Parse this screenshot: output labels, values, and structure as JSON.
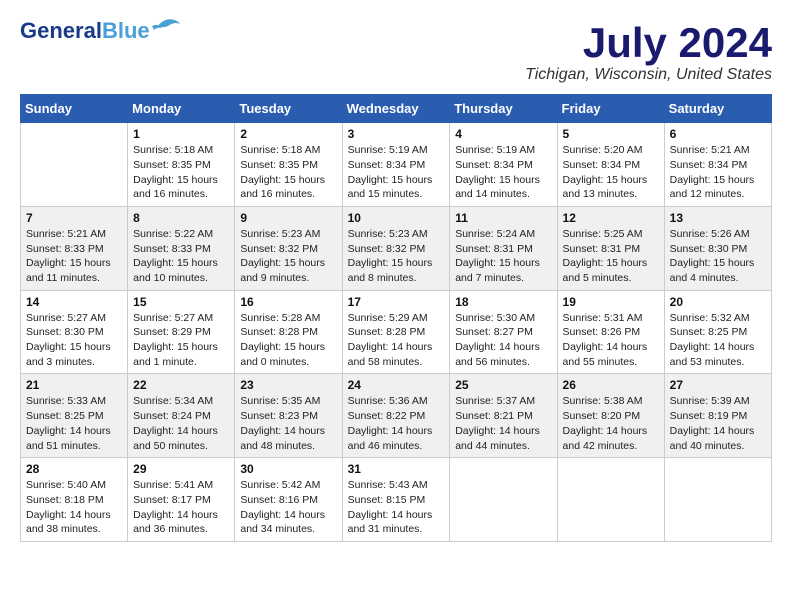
{
  "header": {
    "logo_line1": "General",
    "logo_line2": "Blue",
    "month_title": "July 2024",
    "location": "Tichigan, Wisconsin, United States"
  },
  "weekdays": [
    "Sunday",
    "Monday",
    "Tuesday",
    "Wednesday",
    "Thursday",
    "Friday",
    "Saturday"
  ],
  "weeks": [
    [
      {
        "day": "",
        "info": ""
      },
      {
        "day": "1",
        "info": "Sunrise: 5:18 AM\nSunset: 8:35 PM\nDaylight: 15 hours\nand 16 minutes."
      },
      {
        "day": "2",
        "info": "Sunrise: 5:18 AM\nSunset: 8:35 PM\nDaylight: 15 hours\nand 16 minutes."
      },
      {
        "day": "3",
        "info": "Sunrise: 5:19 AM\nSunset: 8:34 PM\nDaylight: 15 hours\nand 15 minutes."
      },
      {
        "day": "4",
        "info": "Sunrise: 5:19 AM\nSunset: 8:34 PM\nDaylight: 15 hours\nand 14 minutes."
      },
      {
        "day": "5",
        "info": "Sunrise: 5:20 AM\nSunset: 8:34 PM\nDaylight: 15 hours\nand 13 minutes."
      },
      {
        "day": "6",
        "info": "Sunrise: 5:21 AM\nSunset: 8:34 PM\nDaylight: 15 hours\nand 12 minutes."
      }
    ],
    [
      {
        "day": "7",
        "info": "Sunrise: 5:21 AM\nSunset: 8:33 PM\nDaylight: 15 hours\nand 11 minutes."
      },
      {
        "day": "8",
        "info": "Sunrise: 5:22 AM\nSunset: 8:33 PM\nDaylight: 15 hours\nand 10 minutes."
      },
      {
        "day": "9",
        "info": "Sunrise: 5:23 AM\nSunset: 8:32 PM\nDaylight: 15 hours\nand 9 minutes."
      },
      {
        "day": "10",
        "info": "Sunrise: 5:23 AM\nSunset: 8:32 PM\nDaylight: 15 hours\nand 8 minutes."
      },
      {
        "day": "11",
        "info": "Sunrise: 5:24 AM\nSunset: 8:31 PM\nDaylight: 15 hours\nand 7 minutes."
      },
      {
        "day": "12",
        "info": "Sunrise: 5:25 AM\nSunset: 8:31 PM\nDaylight: 15 hours\nand 5 minutes."
      },
      {
        "day": "13",
        "info": "Sunrise: 5:26 AM\nSunset: 8:30 PM\nDaylight: 15 hours\nand 4 minutes."
      }
    ],
    [
      {
        "day": "14",
        "info": "Sunrise: 5:27 AM\nSunset: 8:30 PM\nDaylight: 15 hours\nand 3 minutes."
      },
      {
        "day": "15",
        "info": "Sunrise: 5:27 AM\nSunset: 8:29 PM\nDaylight: 15 hours\nand 1 minute."
      },
      {
        "day": "16",
        "info": "Sunrise: 5:28 AM\nSunset: 8:28 PM\nDaylight: 15 hours\nand 0 minutes."
      },
      {
        "day": "17",
        "info": "Sunrise: 5:29 AM\nSunset: 8:28 PM\nDaylight: 14 hours\nand 58 minutes."
      },
      {
        "day": "18",
        "info": "Sunrise: 5:30 AM\nSunset: 8:27 PM\nDaylight: 14 hours\nand 56 minutes."
      },
      {
        "day": "19",
        "info": "Sunrise: 5:31 AM\nSunset: 8:26 PM\nDaylight: 14 hours\nand 55 minutes."
      },
      {
        "day": "20",
        "info": "Sunrise: 5:32 AM\nSunset: 8:25 PM\nDaylight: 14 hours\nand 53 minutes."
      }
    ],
    [
      {
        "day": "21",
        "info": "Sunrise: 5:33 AM\nSunset: 8:25 PM\nDaylight: 14 hours\nand 51 minutes."
      },
      {
        "day": "22",
        "info": "Sunrise: 5:34 AM\nSunset: 8:24 PM\nDaylight: 14 hours\nand 50 minutes."
      },
      {
        "day": "23",
        "info": "Sunrise: 5:35 AM\nSunset: 8:23 PM\nDaylight: 14 hours\nand 48 minutes."
      },
      {
        "day": "24",
        "info": "Sunrise: 5:36 AM\nSunset: 8:22 PM\nDaylight: 14 hours\nand 46 minutes."
      },
      {
        "day": "25",
        "info": "Sunrise: 5:37 AM\nSunset: 8:21 PM\nDaylight: 14 hours\nand 44 minutes."
      },
      {
        "day": "26",
        "info": "Sunrise: 5:38 AM\nSunset: 8:20 PM\nDaylight: 14 hours\nand 42 minutes."
      },
      {
        "day": "27",
        "info": "Sunrise: 5:39 AM\nSunset: 8:19 PM\nDaylight: 14 hours\nand 40 minutes."
      }
    ],
    [
      {
        "day": "28",
        "info": "Sunrise: 5:40 AM\nSunset: 8:18 PM\nDaylight: 14 hours\nand 38 minutes."
      },
      {
        "day": "29",
        "info": "Sunrise: 5:41 AM\nSunset: 8:17 PM\nDaylight: 14 hours\nand 36 minutes."
      },
      {
        "day": "30",
        "info": "Sunrise: 5:42 AM\nSunset: 8:16 PM\nDaylight: 14 hours\nand 34 minutes."
      },
      {
        "day": "31",
        "info": "Sunrise: 5:43 AM\nSunset: 8:15 PM\nDaylight: 14 hours\nand 31 minutes."
      },
      {
        "day": "",
        "info": ""
      },
      {
        "day": "",
        "info": ""
      },
      {
        "day": "",
        "info": ""
      }
    ]
  ]
}
